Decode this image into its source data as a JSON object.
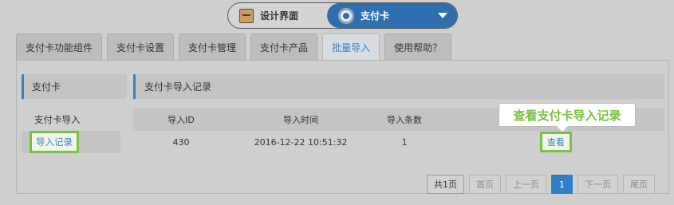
{
  "switcher": {
    "left_label": "设计界面",
    "right_label": "支付卡",
    "left_icon": "design-tool-icon",
    "right_icon": "gear-icon"
  },
  "tabs": [
    {
      "label": "支付卡功能组件"
    },
    {
      "label": "支付卡设置"
    },
    {
      "label": "支付卡管理"
    },
    {
      "label": "支付卡产品"
    },
    {
      "label": "批量导入"
    },
    {
      "label": "使用帮助？"
    }
  ],
  "sidebar": {
    "title": "支付卡",
    "items": [
      {
        "label": "支付卡导入"
      },
      {
        "label": "导入记录"
      }
    ]
  },
  "main": {
    "title": "支付卡导入记录",
    "columns": [
      "导入ID",
      "导入时间",
      "导入条数",
      ""
    ],
    "rows": [
      {
        "id": "430",
        "time": "2016-12-22 10:51:32",
        "count": "1",
        "action": "查看"
      }
    ]
  },
  "tooltip": {
    "text": "查看支付卡导入记录"
  },
  "pager": {
    "total": "共1页",
    "first": "首页",
    "prev": "上一页",
    "current": "1",
    "next": "下一页",
    "last": "尾页"
  },
  "colors": {
    "accent": "#3b7fc4",
    "highlight": "#7ac143",
    "switch_bg": "#2f6fb0"
  }
}
